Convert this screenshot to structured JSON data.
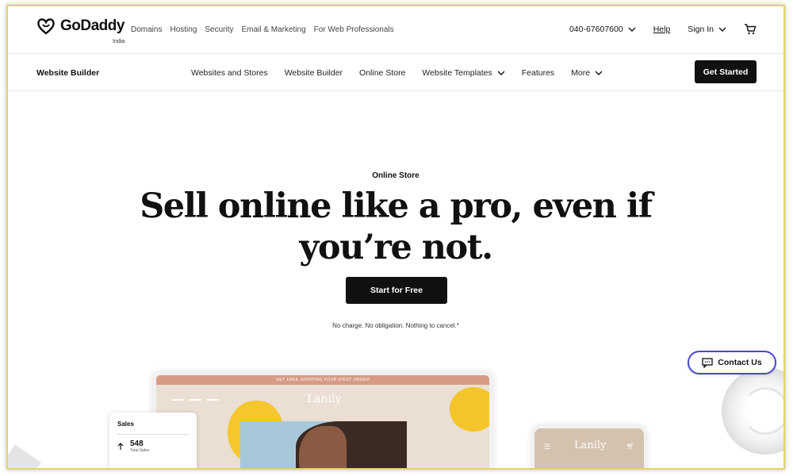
{
  "header": {
    "logo_text": "GoDaddy",
    "region": "India",
    "nav": [
      "Domains",
      "Hosting",
      "Security",
      "Email & Marketing",
      "For Web Professionals"
    ],
    "phone": "040-67607600",
    "help": "Help",
    "sign_in": "Sign In"
  },
  "subnav": {
    "brand": "Website Builder",
    "links": [
      "Websites and Stores",
      "Website Builder",
      "Online Store",
      "Website Templates",
      "Features",
      "More"
    ],
    "cta": "Get Started"
  },
  "hero": {
    "eyebrow": "Online Store",
    "headline_line1": "Sell online like a pro, even if",
    "headline_line2": "you’re not.",
    "cta": "Start for Free",
    "disclaimer": "No charge. No obligation. Nothing to cancel.*"
  },
  "contact": {
    "label": "Contact Us"
  },
  "mockups": {
    "laptop_banner": "GET FREE SHIPPING YOUR FIRST ORDER",
    "laptop_brand": "Lanily",
    "phone_brand": "Lanily",
    "sales_title": "Sales",
    "sales_value": "548",
    "sales_sub": "Total Sales"
  },
  "colors": {
    "accent": "#111111",
    "frame": "#e2d36a",
    "contact_border": "#4a4ad0"
  }
}
